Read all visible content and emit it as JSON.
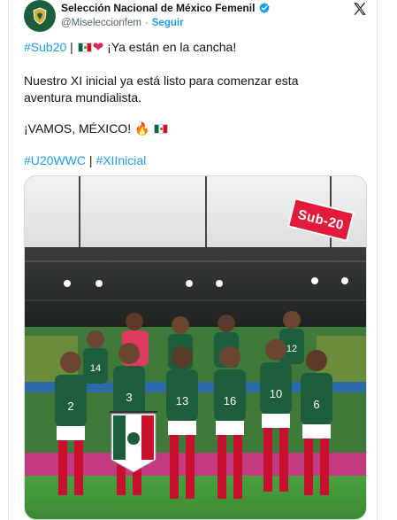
{
  "account": {
    "name": "Selección Nacional de México Femenil",
    "handle": "@Miseleccionfem",
    "separator": "·",
    "follow_label": "Seguir"
  },
  "tweet": {
    "line1_hashtag": "#Sub20",
    "line1_sep": " | ",
    "line1_text": " ¡Ya están en la cancha!",
    "line2": "Nuestro XI inicial ya está listo para comenzar esta",
    "line3": "aventura mundialista.",
    "line4": "¡VAMOS, MÉXICO! ",
    "hashtag_a": "#U20WWC",
    "hashtag_sep": " | ",
    "hashtag_b": "#XIInicial"
  },
  "media": {
    "badge_text": "Sub-20",
    "jersey_numbers": [
      "2",
      "3",
      "13",
      "16",
      "10",
      "6",
      "14",
      "12"
    ]
  },
  "icons": {
    "verified": "verified-badge-icon",
    "x_logo": "x-logo-icon",
    "flag": "mexico-flag-icon",
    "heart": "red-heart-icon",
    "fire": "fire-icon"
  },
  "colors": {
    "link": "#1d9bf0",
    "jersey": "#1c5e3b",
    "badge": "#e21b3c"
  }
}
